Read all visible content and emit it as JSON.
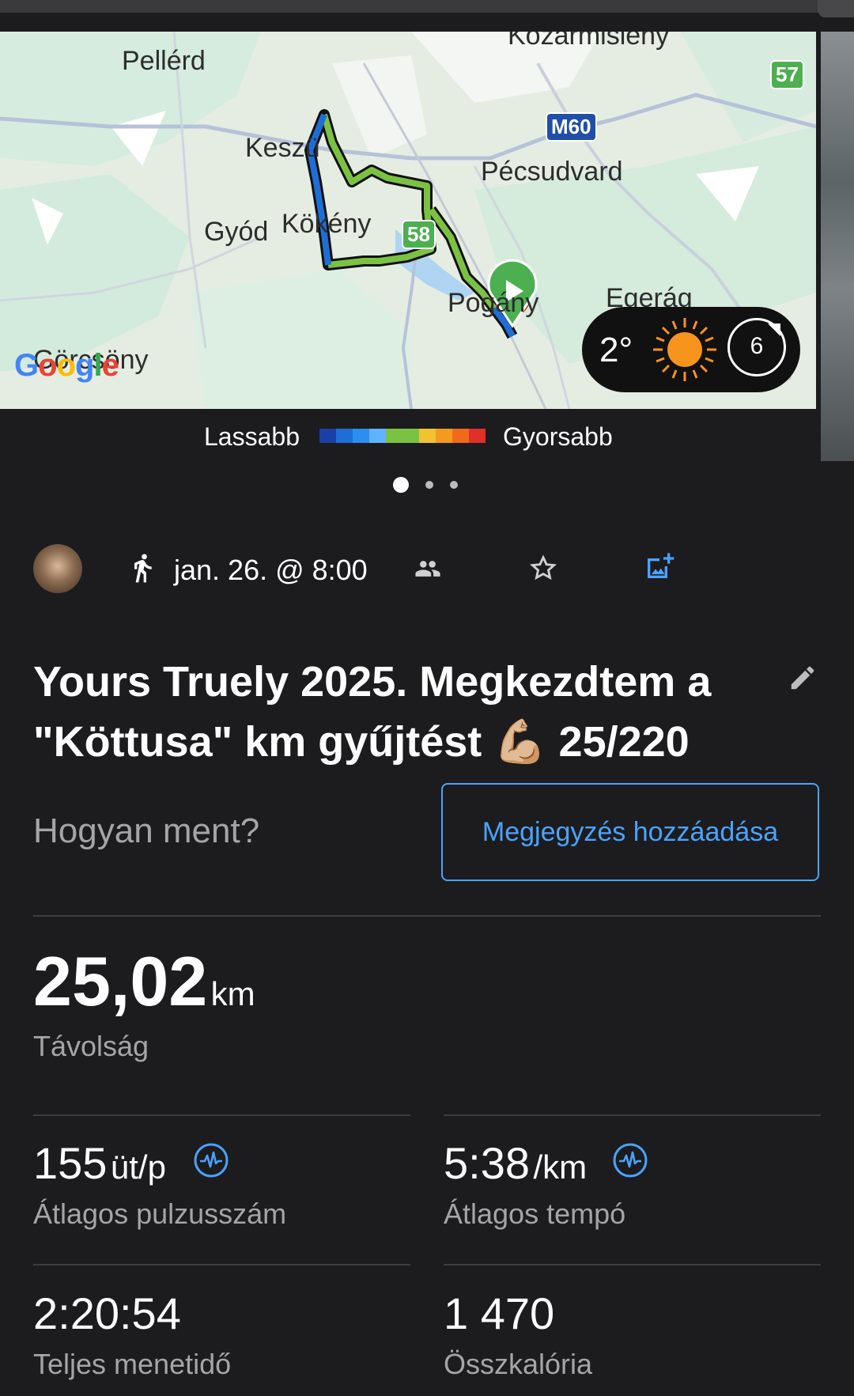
{
  "map": {
    "places": {
      "kozarmisleny": "Kozármisleny",
      "pellerd": "Pellérd",
      "keszu": "Keszü",
      "pecsudvard": "Pécsudvard",
      "gyod": "Gyód",
      "kokeny": "Kökény",
      "pogany": "Pogány",
      "egerag": "Egerág",
      "gorcsony": "Görcsöny"
    },
    "roads": {
      "r57": "57",
      "m60": "M60",
      "r58": "58"
    },
    "google_logo": "Google",
    "route_color_fast": "#7cc242",
    "route_color_slow": "#1e6ed6"
  },
  "weather": {
    "temp": "2°",
    "icon": "sun-icon",
    "wind": "6"
  },
  "legend": {
    "slow": "Lassabb",
    "fast": "Gyorsabb",
    "colors": [
      "#1a3fa6",
      "#1e6ed6",
      "#2b8ff0",
      "#5fb3ff",
      "#7cc242",
      "#7cc242",
      "#f2c230",
      "#f39a1f",
      "#f06a1a",
      "#e0302a"
    ]
  },
  "pager": {
    "count": 3,
    "active": 0
  },
  "activity": {
    "type_icon": "running-icon",
    "date": "jan. 26. @ 8:00",
    "title": "Yours Truely 2025. Megkezdtem a \"Köttusa\" km gyűjtést 💪🏼 25/220"
  },
  "feeling": {
    "prompt": "Hogyan ment?",
    "add_note": "Megjegyzés hozzáadása"
  },
  "stats": {
    "distance": {
      "value": "25,02",
      "unit": "km",
      "label": "Távolság"
    },
    "avg_hr": {
      "value": "155",
      "unit": "üt/p",
      "label": "Átlagos pulzusszám"
    },
    "avg_pace": {
      "value": "5:38",
      "unit": "/km",
      "label": "Átlagos tempó"
    },
    "total_time": {
      "value": "2:20:54",
      "label": "Teljes menetidő"
    },
    "calories": {
      "value": "1 470",
      "label": "Összkalória"
    }
  },
  "colors": {
    "accent": "#4aa3ff",
    "background": "#1c1c1e"
  }
}
